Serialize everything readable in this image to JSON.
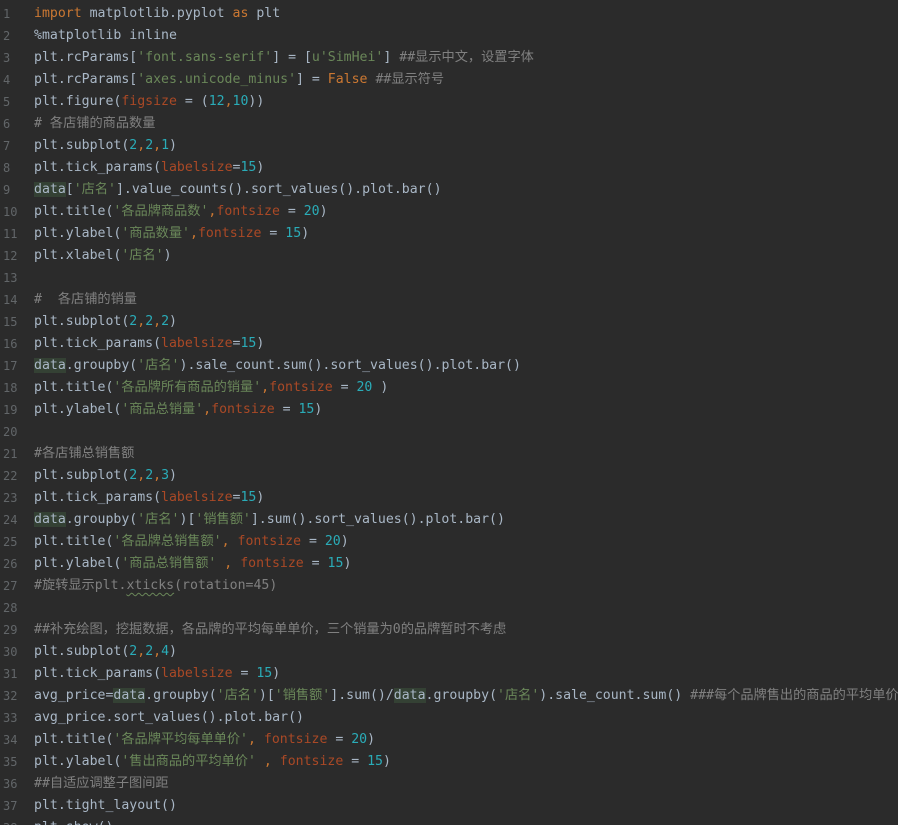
{
  "editor": {
    "theme_colors": {
      "background": "#2b2b2b",
      "text": "#a9b7c6",
      "keyword": "#cc7832",
      "string": "#6a8759",
      "number": "#2aacb8",
      "parameter": "#aa4926",
      "comment": "#808080",
      "line_number": "#626669"
    },
    "lines": [
      {
        "number": "1",
        "tokens": [
          {
            "t": "import",
            "c": "kw"
          },
          {
            "t": " matplotlib.pyplot ",
            "c": "plain"
          },
          {
            "t": "as",
            "c": "kw"
          },
          {
            "t": " plt",
            "c": "plain"
          }
        ]
      },
      {
        "number": "2",
        "tokens": [
          {
            "t": "%matplotlib inline",
            "c": "plain"
          }
        ]
      },
      {
        "number": "3",
        "tokens": [
          {
            "t": "plt.rcParams[",
            "c": "plain"
          },
          {
            "t": "'font.sans-serif'",
            "c": "str"
          },
          {
            "t": "] = [",
            "c": "plain"
          },
          {
            "t": "u'SimHei'",
            "c": "str"
          },
          {
            "t": "] ",
            "c": "plain"
          },
          {
            "t": "##显示中文，设置字体",
            "c": "comment"
          }
        ]
      },
      {
        "number": "4",
        "tokens": [
          {
            "t": "plt.rcParams[",
            "c": "plain"
          },
          {
            "t": "'axes.unicode_minus'",
            "c": "str"
          },
          {
            "t": "] = ",
            "c": "plain"
          },
          {
            "t": "False",
            "c": "kw"
          },
          {
            "t": " ",
            "c": "plain"
          },
          {
            "t": "##显示符号",
            "c": "comment"
          }
        ]
      },
      {
        "number": "5",
        "tokens": [
          {
            "t": "plt.figure(",
            "c": "plain"
          },
          {
            "t": "figsize",
            "c": "param"
          },
          {
            "t": " = (",
            "c": "plain"
          },
          {
            "t": "12",
            "c": "num"
          },
          {
            "t": ",",
            "c": "kw"
          },
          {
            "t": "10",
            "c": "num"
          },
          {
            "t": "))",
            "c": "plain"
          }
        ]
      },
      {
        "number": "6",
        "tokens": [
          {
            "t": "# 各店铺的商品数量",
            "c": "comment"
          }
        ]
      },
      {
        "number": "7",
        "tokens": [
          {
            "t": "plt.subplot(",
            "c": "plain"
          },
          {
            "t": "2",
            "c": "num"
          },
          {
            "t": ",",
            "c": "kw"
          },
          {
            "t": "2",
            "c": "num"
          },
          {
            "t": ",",
            "c": "kw"
          },
          {
            "t": "1",
            "c": "num"
          },
          {
            "t": ")",
            "c": "plain"
          }
        ]
      },
      {
        "number": "8",
        "tokens": [
          {
            "t": "plt.tick_params(",
            "c": "plain"
          },
          {
            "t": "labelsize",
            "c": "param"
          },
          {
            "t": "=",
            "c": "plain"
          },
          {
            "t": "15",
            "c": "num"
          },
          {
            "t": ")",
            "c": "plain"
          }
        ]
      },
      {
        "number": "9",
        "tokens": [
          {
            "t": "data",
            "c": "plain varhl"
          },
          {
            "t": "[",
            "c": "plain"
          },
          {
            "t": "'店名'",
            "c": "str"
          },
          {
            "t": "].value_counts().sort_values().plot.bar()",
            "c": "plain"
          }
        ]
      },
      {
        "number": "10",
        "tokens": [
          {
            "t": "plt.title(",
            "c": "plain"
          },
          {
            "t": "'各品牌商品数'",
            "c": "str"
          },
          {
            "t": ",",
            "c": "kw"
          },
          {
            "t": "fontsize",
            "c": "param"
          },
          {
            "t": " = ",
            "c": "plain"
          },
          {
            "t": "20",
            "c": "num"
          },
          {
            "t": ")",
            "c": "plain"
          }
        ]
      },
      {
        "number": "11",
        "tokens": [
          {
            "t": "plt.ylabel(",
            "c": "plain"
          },
          {
            "t": "'商品数量'",
            "c": "str"
          },
          {
            "t": ",",
            "c": "kw"
          },
          {
            "t": "fontsize",
            "c": "param"
          },
          {
            "t": " = ",
            "c": "plain"
          },
          {
            "t": "15",
            "c": "num"
          },
          {
            "t": ")",
            "c": "plain"
          }
        ]
      },
      {
        "number": "12",
        "tokens": [
          {
            "t": "plt.xlabel(",
            "c": "plain"
          },
          {
            "t": "'店名'",
            "c": "str"
          },
          {
            "t": ")",
            "c": "plain"
          }
        ]
      },
      {
        "number": "13",
        "tokens": []
      },
      {
        "number": "14",
        "tokens": [
          {
            "t": "#  各店铺的销量",
            "c": "comment"
          }
        ]
      },
      {
        "number": "15",
        "tokens": [
          {
            "t": "plt.subplot(",
            "c": "plain"
          },
          {
            "t": "2",
            "c": "num"
          },
          {
            "t": ",",
            "c": "kw"
          },
          {
            "t": "2",
            "c": "num"
          },
          {
            "t": ",",
            "c": "kw"
          },
          {
            "t": "2",
            "c": "num"
          },
          {
            "t": ")",
            "c": "plain"
          }
        ]
      },
      {
        "number": "16",
        "tokens": [
          {
            "t": "plt.tick_params(",
            "c": "plain"
          },
          {
            "t": "labelsize",
            "c": "param"
          },
          {
            "t": "=",
            "c": "plain"
          },
          {
            "t": "15",
            "c": "num"
          },
          {
            "t": ")",
            "c": "plain"
          }
        ]
      },
      {
        "number": "17",
        "tokens": [
          {
            "t": "data",
            "c": "plain varhl"
          },
          {
            "t": ".groupby(",
            "c": "plain"
          },
          {
            "t": "'店名'",
            "c": "str"
          },
          {
            "t": ").sale_count.sum().sort_values().plot.bar()",
            "c": "plain"
          }
        ]
      },
      {
        "number": "18",
        "tokens": [
          {
            "t": "plt.title(",
            "c": "plain"
          },
          {
            "t": "'各品牌所有商品的销量'",
            "c": "str"
          },
          {
            "t": ",",
            "c": "kw"
          },
          {
            "t": "fontsize",
            "c": "param"
          },
          {
            "t": " = ",
            "c": "plain"
          },
          {
            "t": "20",
            "c": "num"
          },
          {
            "t": " )",
            "c": "plain"
          }
        ]
      },
      {
        "number": "19",
        "tokens": [
          {
            "t": "plt.ylabel(",
            "c": "plain"
          },
          {
            "t": "'商品总销量'",
            "c": "str"
          },
          {
            "t": ",",
            "c": "kw"
          },
          {
            "t": "fontsize",
            "c": "param"
          },
          {
            "t": " = ",
            "c": "plain"
          },
          {
            "t": "15",
            "c": "num"
          },
          {
            "t": ")",
            "c": "plain"
          }
        ]
      },
      {
        "number": "20",
        "tokens": []
      },
      {
        "number": "21",
        "tokens": [
          {
            "t": "#各店铺总销售额",
            "c": "comment"
          }
        ]
      },
      {
        "number": "22",
        "tokens": [
          {
            "t": "plt.subplot(",
            "c": "plain"
          },
          {
            "t": "2",
            "c": "num"
          },
          {
            "t": ",",
            "c": "kw"
          },
          {
            "t": "2",
            "c": "num"
          },
          {
            "t": ",",
            "c": "kw"
          },
          {
            "t": "3",
            "c": "num"
          },
          {
            "t": ")",
            "c": "plain"
          }
        ]
      },
      {
        "number": "23",
        "tokens": [
          {
            "t": "plt.tick_params(",
            "c": "plain"
          },
          {
            "t": "labelsize",
            "c": "param"
          },
          {
            "t": "=",
            "c": "plain"
          },
          {
            "t": "15",
            "c": "num"
          },
          {
            "t": ")",
            "c": "plain"
          }
        ]
      },
      {
        "number": "24",
        "tokens": [
          {
            "t": "data",
            "c": "plain varhl"
          },
          {
            "t": ".groupby(",
            "c": "plain"
          },
          {
            "t": "'店名'",
            "c": "str"
          },
          {
            "t": ")[",
            "c": "plain"
          },
          {
            "t": "'销售额'",
            "c": "str"
          },
          {
            "t": "].sum().sort_values().plot.bar()",
            "c": "plain"
          }
        ]
      },
      {
        "number": "25",
        "tokens": [
          {
            "t": "plt.title(",
            "c": "plain"
          },
          {
            "t": "'各品牌总销售额'",
            "c": "str"
          },
          {
            "t": ", ",
            "c": "kw"
          },
          {
            "t": "fontsize",
            "c": "param"
          },
          {
            "t": " = ",
            "c": "plain"
          },
          {
            "t": "20",
            "c": "num"
          },
          {
            "t": ")",
            "c": "plain"
          }
        ]
      },
      {
        "number": "26",
        "tokens": [
          {
            "t": "plt.ylabel(",
            "c": "plain"
          },
          {
            "t": "'商品总销售额'",
            "c": "str"
          },
          {
            "t": " , ",
            "c": "kw"
          },
          {
            "t": "fontsize",
            "c": "param"
          },
          {
            "t": " = ",
            "c": "plain"
          },
          {
            "t": "15",
            "c": "num"
          },
          {
            "t": ")",
            "c": "plain"
          }
        ]
      },
      {
        "number": "27",
        "tokens": [
          {
            "t": "#旋转显示plt.",
            "c": "comment"
          },
          {
            "t": "xticks",
            "c": "comment wavy"
          },
          {
            "t": "(rotation=45)",
            "c": "comment"
          }
        ]
      },
      {
        "number": "28",
        "tokens": []
      },
      {
        "number": "29",
        "tokens": [
          {
            "t": "##补充绘图，挖掘数据，各品牌的平均每单单价，三个销量为0的品牌暂时不考虑",
            "c": "comment"
          }
        ]
      },
      {
        "number": "30",
        "tokens": [
          {
            "t": "plt.subplot(",
            "c": "plain"
          },
          {
            "t": "2",
            "c": "num"
          },
          {
            "t": ",",
            "c": "kw"
          },
          {
            "t": "2",
            "c": "num"
          },
          {
            "t": ",",
            "c": "kw"
          },
          {
            "t": "4",
            "c": "num"
          },
          {
            "t": ")",
            "c": "plain"
          }
        ]
      },
      {
        "number": "31",
        "tokens": [
          {
            "t": "plt.tick_params(",
            "c": "plain"
          },
          {
            "t": "labelsize",
            "c": "param"
          },
          {
            "t": " = ",
            "c": "plain"
          },
          {
            "t": "15",
            "c": "num"
          },
          {
            "t": ")",
            "c": "plain"
          }
        ]
      },
      {
        "number": "32",
        "tokens": [
          {
            "t": "avg_price=",
            "c": "plain"
          },
          {
            "t": "data",
            "c": "plain varhl"
          },
          {
            "t": ".groupby(",
            "c": "plain"
          },
          {
            "t": "'店名'",
            "c": "str"
          },
          {
            "t": ")[",
            "c": "plain"
          },
          {
            "t": "'销售额'",
            "c": "str"
          },
          {
            "t": "].sum()/",
            "c": "plain"
          },
          {
            "t": "data",
            "c": "plain varhl"
          },
          {
            "t": ".groupby(",
            "c": "plain"
          },
          {
            "t": "'店名'",
            "c": "str"
          },
          {
            "t": ").sale_count.sum() ",
            "c": "plain"
          },
          {
            "t": "###每个品牌售出的商品的平均单价",
            "c": "comment"
          }
        ]
      },
      {
        "number": "33",
        "tokens": [
          {
            "t": "avg_price.sort_values().plot.bar()",
            "c": "plain"
          }
        ]
      },
      {
        "number": "34",
        "tokens": [
          {
            "t": "plt.title(",
            "c": "plain"
          },
          {
            "t": "'各品牌平均每单单价'",
            "c": "str"
          },
          {
            "t": ", ",
            "c": "kw"
          },
          {
            "t": "fontsize",
            "c": "param"
          },
          {
            "t": " = ",
            "c": "plain"
          },
          {
            "t": "20",
            "c": "num"
          },
          {
            "t": ")",
            "c": "plain"
          }
        ]
      },
      {
        "number": "35",
        "tokens": [
          {
            "t": "plt.ylabel(",
            "c": "plain"
          },
          {
            "t": "'售出商品的平均单价'",
            "c": "str"
          },
          {
            "t": " , ",
            "c": "kw"
          },
          {
            "t": "fontsize",
            "c": "param"
          },
          {
            "t": " = ",
            "c": "plain"
          },
          {
            "t": "15",
            "c": "num"
          },
          {
            "t": ")",
            "c": "plain"
          }
        ]
      },
      {
        "number": "36",
        "tokens": [
          {
            "t": "##自适应调整子图间距",
            "c": "comment"
          }
        ]
      },
      {
        "number": "37",
        "tokens": [
          {
            "t": "plt.tight_layout()",
            "c": "plain"
          }
        ]
      },
      {
        "number": "38",
        "tokens": [
          {
            "t": "plt.show()",
            "c": "plain"
          }
        ]
      }
    ]
  }
}
